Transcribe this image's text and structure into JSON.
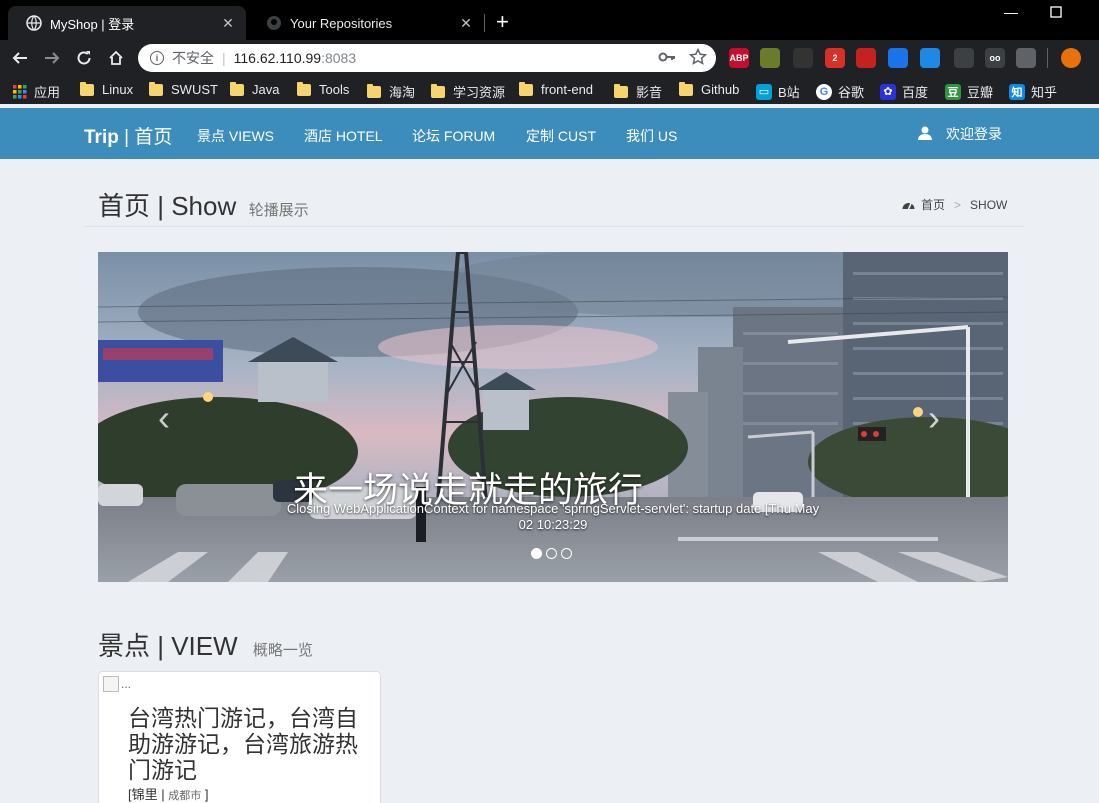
{
  "browser": {
    "tabs": [
      {
        "title": "MyShop | 登录",
        "active": true
      },
      {
        "title": "Your Repositories",
        "active": false
      }
    ],
    "new_tab": "+",
    "address": {
      "security_label": "不安全",
      "divider": "|",
      "host": "116.62.110.99",
      "port": ":8083"
    },
    "extensions": [
      {
        "name": "adblock-plus-icon",
        "label": "ABP",
        "color": "#c70d2c"
      },
      {
        "name": "extension-icon-2",
        "label": "",
        "color": "#6a7b2a"
      },
      {
        "name": "extension-icon-3",
        "label": "",
        "color": "#333333"
      },
      {
        "name": "extension-icon-4",
        "label": "2",
        "color": "#d93025"
      },
      {
        "name": "pdf-icon",
        "label": "",
        "color": "#c5221f"
      },
      {
        "name": "diamond-icon",
        "label": "",
        "color": "#1a73e8"
      },
      {
        "name": "extension-icon-7",
        "label": "",
        "color": "#1e88e5"
      },
      {
        "name": "extension-icon-8",
        "label": "",
        "color": "#3c4043"
      },
      {
        "name": "extension-icon-9",
        "label": "oo",
        "color": "#3c4043"
      },
      {
        "name": "vue-icon",
        "label": "",
        "color": "#5f6368"
      },
      {
        "name": "profile-avatar",
        "label": "",
        "color": "#e8710a"
      }
    ],
    "bookmarks": [
      {
        "label": "应用",
        "type": "apps"
      },
      {
        "label": "Linux",
        "type": "folder"
      },
      {
        "label": "SWUST",
        "type": "folder"
      },
      {
        "label": "Java",
        "type": "folder"
      },
      {
        "label": "Tools",
        "type": "folder"
      },
      {
        "label": "海淘",
        "type": "folder"
      },
      {
        "label": "学习资源",
        "type": "folder"
      },
      {
        "label": "front-end",
        "type": "folder"
      },
      {
        "label": "影音",
        "type": "folder"
      },
      {
        "label": "Github",
        "type": "folder"
      },
      {
        "label": "B站",
        "type": "bilibili"
      },
      {
        "label": "谷歌",
        "type": "google"
      },
      {
        "label": "百度",
        "type": "baidu"
      },
      {
        "label": "豆瓣",
        "type": "douban"
      },
      {
        "label": "知乎",
        "type": "zhihu"
      }
    ]
  },
  "site": {
    "brand": {
      "bold": "Trip",
      "sep": " | ",
      "rest": "首页"
    },
    "nav": [
      "景点 VIEWS",
      "酒店 HOTEL",
      "论坛 FORUM",
      "定制 CUST",
      "我们 US"
    ],
    "login_label": "欢迎登录",
    "accent": "#3c8dbc"
  },
  "page": {
    "title": "首页 | Show",
    "subtitle": "轮播展示",
    "breadcrumb": {
      "home": "首页",
      "sep": ">",
      "current": "SHOW"
    }
  },
  "carousel": {
    "caption_title": "来一场说走就走的旅行",
    "caption_body": "Closing WebApplicationContext for namespace 'springServlet-servlet': startup date [Thu May 02 10:23:29",
    "slides": 3,
    "active_slide": 1
  },
  "view_section": {
    "title": "景点 | VIEW",
    "subtitle": "概略一览",
    "cards": [
      {
        "img_alt": "...",
        "title": "台湾热门游记，台湾自助游游记，台湾旅游热门游记",
        "loc_open": "[锦里 | ",
        "city": "成都市",
        "loc_close": " ]"
      }
    ]
  }
}
